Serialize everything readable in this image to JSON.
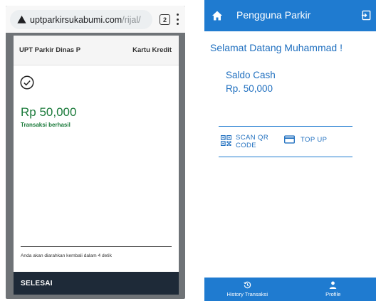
{
  "browser": {
    "url_host": "uptparkirsukabumi.com",
    "url_path": "/rijal/",
    "tab_count": "2"
  },
  "payment": {
    "merchant": "UPT Parkir Dinas P",
    "method": "Kartu Kredit",
    "amount": "Rp 50,000",
    "status": "Transaksi berhasil",
    "redirect_note": "Anda akan diarahkan kembali dalam 4 detik",
    "finish_label": "SELESAI"
  },
  "app": {
    "title": "Pengguna Parkir",
    "welcome": "Selamat Datang Muhammad !",
    "balance_label": "Saldo Cash",
    "balance_value": "Rp. 50,000",
    "scan_label": "SCAN QR CODE",
    "topup_label": "TOP UP",
    "nav": [
      {
        "label": "History Transaksi",
        "icon": "history-icon"
      },
      {
        "label": "Profile",
        "icon": "person-icon"
      }
    ]
  },
  "colors": {
    "app_blue": "#1f7bd0",
    "success_green": "#1a7a3a",
    "finish_bar": "#1e2a38"
  }
}
